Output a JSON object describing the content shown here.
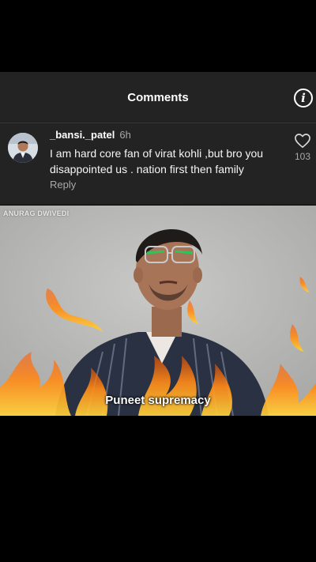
{
  "header": {
    "title": "Comments",
    "info_icon": "info-icon"
  },
  "comment": {
    "username": "_bansi._patel",
    "time": "6h",
    "text": "I am hard core fan of virat kohli ,but bro you disappointed us . nation first then family",
    "reply_label": "Reply",
    "like_icon": "heart-icon",
    "like_count": "103"
  },
  "video": {
    "watermark": "ANURAG DWIVEDI",
    "caption": "Puneet supremacy"
  }
}
